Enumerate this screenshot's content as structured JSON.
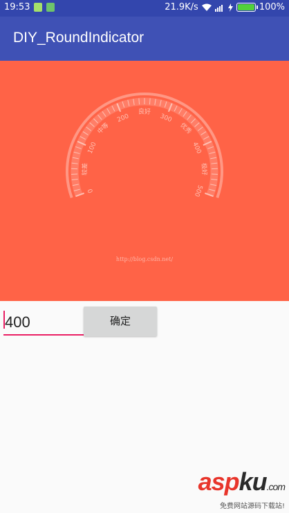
{
  "status_bar": {
    "time": "19:53",
    "left_icons": [
      "sim-card-icon",
      "android-icon"
    ],
    "network_speed": "21.9K/s",
    "right_icons": [
      "wifi-icon",
      "signal-icon",
      "charging-icon",
      "battery-icon"
    ],
    "battery_percent": "100%",
    "battery_level": 1.0
  },
  "app_bar": {
    "title": "DIY_RoundIndicator"
  },
  "gauge": {
    "type": "round-indicator",
    "min": 0,
    "max": 500,
    "value": 0,
    "scale_labels": [
      "0",
      "100",
      "200",
      "300",
      "400",
      "500"
    ],
    "rating_labels": [
      "较差",
      "中等",
      "良好",
      "优秀",
      "极好"
    ],
    "watermark_url": "http://blog.csdn.net/",
    "colors": {
      "background": "#ff6347",
      "arc": "#ffa08f",
      "tick": "#ffc2b5"
    }
  },
  "input": {
    "value": "400"
  },
  "confirm_button": {
    "label": "确定"
  },
  "watermark": {
    "brand_a": "asp",
    "brand_b": "ku",
    "brand_tld": ".com",
    "slogan": "免费网站源码下载站!"
  },
  "colors": {
    "primary": "#3f51b5",
    "primary_dark": "#3346ad",
    "accent": "#e91e63"
  }
}
